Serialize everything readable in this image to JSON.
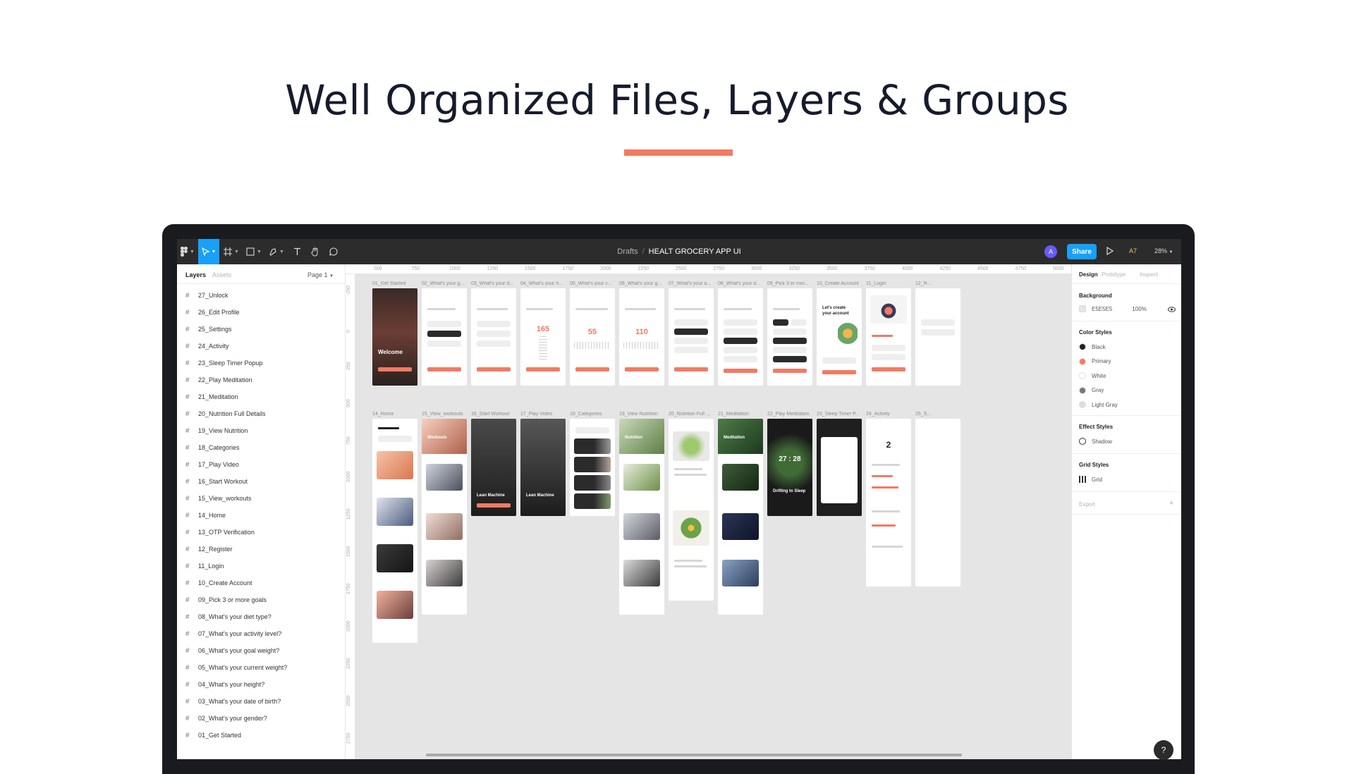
{
  "hero": {
    "title": "Well Organized Files, Layers & Groups"
  },
  "colors": {
    "accent": "#f37a63",
    "toolbar_bg": "#2c2c2c",
    "share_blue": "#18a0fb",
    "canvas_bg": "#e5e5e5"
  },
  "toolbar": {
    "breadcrumb_parent": "Drafts",
    "breadcrumb_separator": "/",
    "file_name": "HEALT GROCERY APP UI",
    "avatar_letter": "A",
    "share_label": "Share",
    "user_code": "A7",
    "zoom_label": "28%",
    "tools": [
      "figma-menu-icon",
      "move-tool-icon",
      "frame-tool-icon",
      "shape-tool-icon",
      "pen-tool-icon",
      "text-tool-icon",
      "hand-tool-icon",
      "comment-tool-icon"
    ]
  },
  "left_panel": {
    "tab_layers": "Layers",
    "tab_assets": "Assets",
    "page_label": "Page 1",
    "layers": [
      "27_Unlock",
      "26_Edit Profile",
      "25_Settings",
      "24_Activity",
      "23_Sleep Timer Popup",
      "22_Play Meditation",
      "21_Meditation",
      "20_Nutrition Full Details",
      "19_View Nutrition",
      "18_Categories",
      "17_Play Video",
      "16_Start Workout",
      "15_View_workouts",
      "14_Home",
      "13_OTP Verification",
      "12_Register",
      "11_Login",
      "10_Create Account",
      "09_Pick 3 or more goals",
      "08_What's your diet type?",
      "07_What's your activity level?",
      "06_What's your goal weight?",
      "05_What's your current weight?",
      "04_What's your height?",
      "03_What's your date of birth?",
      "02_What's your gender?",
      "01_Get Started"
    ]
  },
  "ruler": {
    "top_ticks": [
      "500",
      "750",
      "1000",
      "1250",
      "1500",
      "1750",
      "2000",
      "2250",
      "2500",
      "2750",
      "3000",
      "3250",
      "3500",
      "3750",
      "4000",
      "4250",
      "4500",
      "4750",
      "5000"
    ],
    "left_ticks": [
      "-250",
      "0",
      "250",
      "500",
      "750",
      "1000",
      "1250",
      "1500",
      "1750",
      "2000",
      "2250",
      "2500",
      "2750"
    ]
  },
  "canvas": {
    "row1_labels": [
      "01_Get Started",
      "02_What's your g...",
      "03_What's your d...",
      "04_What's your h...",
      "05_What's your c...",
      "06_What's your g...",
      "07_What's your a...",
      "08_What's your d...",
      "09_Pick 3 or mor...",
      "10_Create Account",
      "11_Login",
      "12_R..."
    ],
    "row2_labels": [
      "14_Home",
      "15_View_workouts",
      "16_Start Workout",
      "17_Play Video",
      "18_Categories",
      "19_View Nutrition",
      "20_Nutrition Full ...",
      "21_Meditation",
      "22_Play Meditation",
      "23_Sleep Timer P...",
      "24_Activity",
      "25_S..."
    ],
    "screen_texts": {
      "welcome": "Welcome",
      "height_value": "165",
      "current_weight": "55",
      "goal_weight": "110",
      "workouts": "Workouts",
      "lean_machine_1": "Lean Machine",
      "lean_machine_2": "Lean Machine",
      "nutrition": "Nutrition",
      "meditation": "Meditation",
      "timer": "27 : 28",
      "drifting": "Drifting to Sleep",
      "activity_count": "2",
      "create_account": "Let's create your account"
    }
  },
  "right_panel": {
    "tab_design": "Design",
    "tab_prototype": "Prototype",
    "tab_inspect": "Inspect",
    "background_label": "Background",
    "background_hex": "E5E5E5",
    "background_opacity": "100%",
    "color_styles_label": "Color Styles",
    "color_styles": [
      {
        "name": "Black",
        "hex": "#222222"
      },
      {
        "name": "Primary",
        "hex": "#f37a63"
      },
      {
        "name": "White",
        "hex": "#ffffff"
      },
      {
        "name": "Gray",
        "hex": "#777777"
      },
      {
        "name": "Light Gray",
        "hex": "#dddddd"
      }
    ],
    "effect_styles_label": "Effect Styles",
    "effect_shadow": "Shadow",
    "grid_styles_label": "Grid Styles",
    "grid_name": "Grid",
    "export_label": "Export",
    "export_add": "+"
  },
  "help": "?"
}
